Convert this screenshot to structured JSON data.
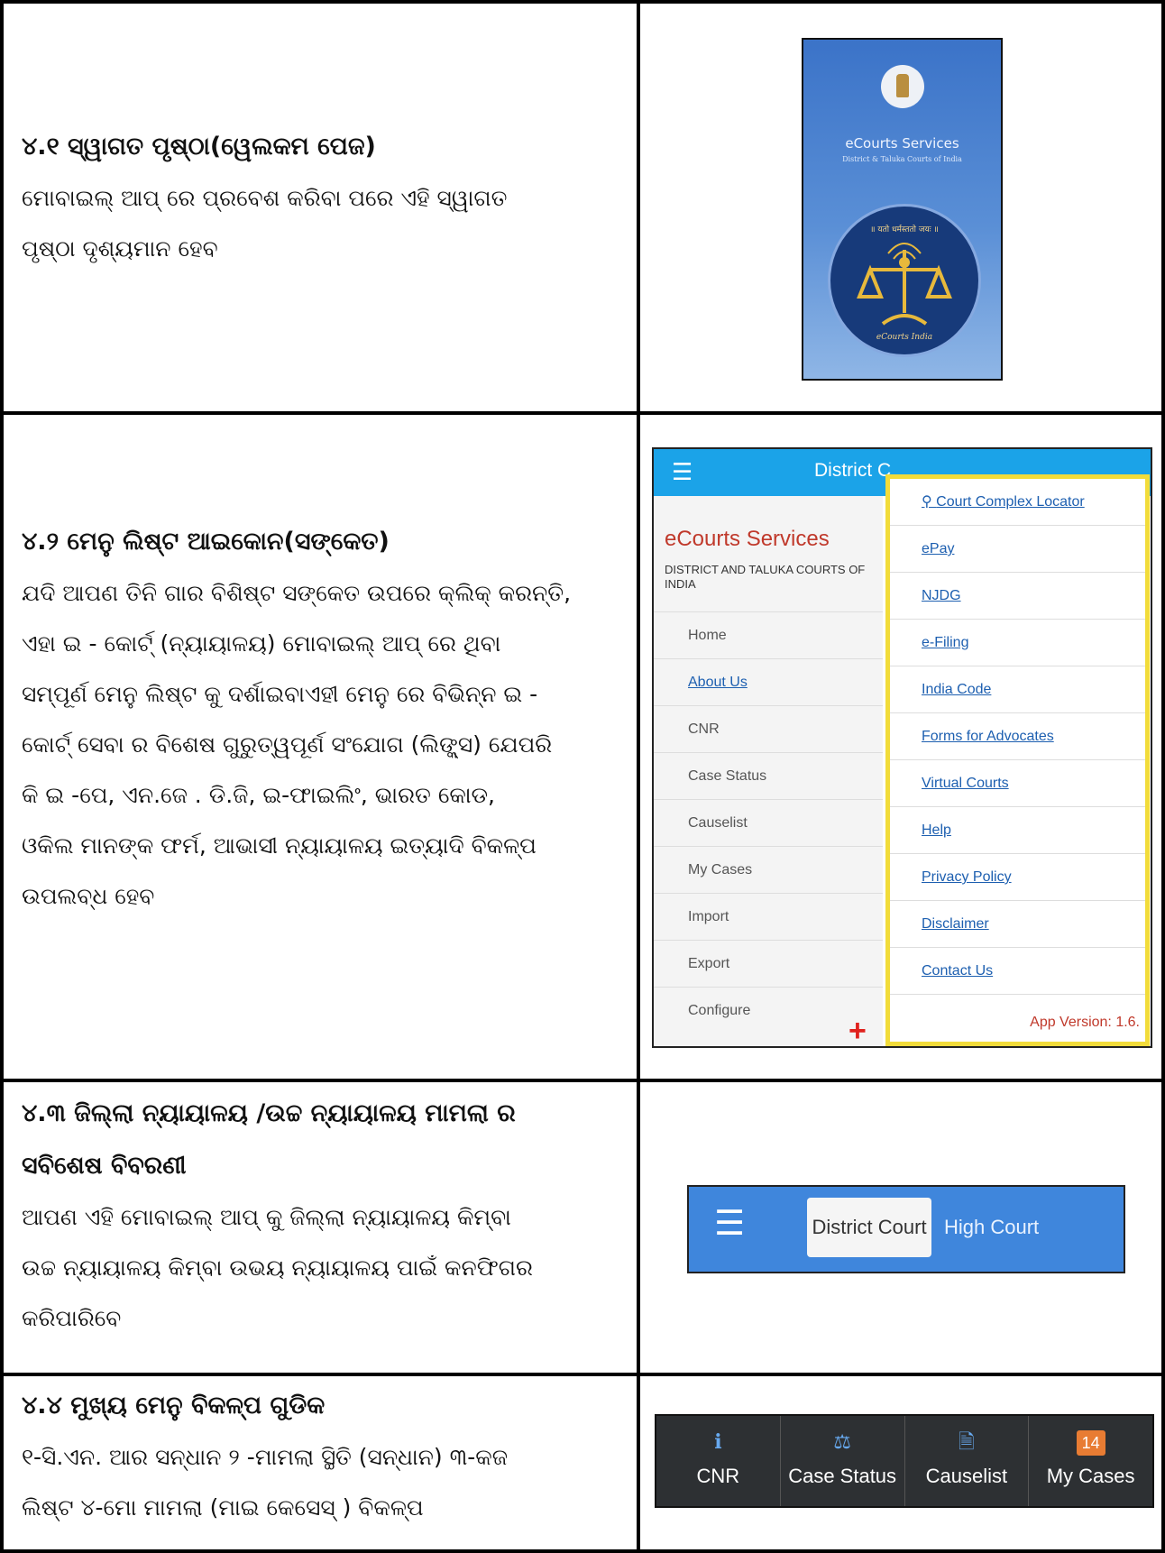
{
  "s41": {
    "heading": "୪.୧ ସ୍ୱାଗତ ପୃଷ୍ଠା(ୱେଲକମ ପେଜ)",
    "line1": "ମୋବାଇଲ୍ ଆପ୍ ରେ ପ୍ରବେଶ କରିବା ପରେ ଏହି ସ୍ୱାଗତ",
    "line2": "ପୃଷ୍ଠା ଦୃଶ୍ୟମାନ ହେବ",
    "screen": {
      "title": "eCourts Services",
      "subtitle": "District & Taluka Courts of India",
      "motto": "॥ यतो धर्मस्ततो जयः ॥",
      "seal_caption": "eCourts India"
    }
  },
  "s42": {
    "heading": "୪.୨ ମେନୁ ଲିଷ୍ଟ ଆଇକୋନ(ସଙ୍କେତ)",
    "lines": [
      " ଯଦି ଆପଣ ତିନି ଗାର ବିଶିଷ୍ଟ ସଙ୍କେତ ଉପରେ କ୍ଲିକ୍ କରନ୍ତି,",
      "ଏହା ଇ -  କୋର୍ଟ୍  (ନ୍ୟାୟାଳୟ)  ମୋବାଇଲ୍ ଆପ୍ ରେ ଥିବା",
      "ସମ୍ପୂର୍ଣ ମେନୁ ଲିଷ୍ଟ କୁ ଦର୍ଶାଇବାଏହୀ ମେନୁ ରେ ବିଭିନ୍ନ ଇ     -",
      "କୋର୍ଟ୍ ସେବା ର ବିଶେଷ ଗୁରୁତ୍ୱପୂର୍ଣ ସଂଯୋଗ (ଲିଙ୍କ୍ସ) ଯେପରି",
      "କି ଇ -ପେ,  ଏନ.ଜେ . ଡି.ଜି,  ଇ-ଫାଇଲିଂ,  ଭାରତ କୋଡ,",
      "ଓକିଲ ମାନଙ୍କ ଫର୍ମ, ଆଭାସୀ ନ୍ୟାୟାଳୟ ଇତ୍ୟାଦି ବିକଳ୍ପ",
      "ଉପଲବ୍ଧ ହେବ"
    ],
    "screen": {
      "bar_title": "District C",
      "brand": "eCourts Services",
      "brand_sub": "DISTRICT AND TALUKA COURTS OF INDIA",
      "left_items": [
        "Home",
        "About Us",
        "CNR",
        "Case Status",
        "Causelist",
        "My Cases",
        "Import",
        "Export",
        "Configure"
      ],
      "right_items": [
        "Court Complex Locator",
        "ePay",
        "NJDG",
        "e-Filing",
        "India Code",
        "Forms for Advocates",
        "Virtual Courts",
        "Help",
        "Privacy Policy",
        "Disclaimer",
        "Contact Us"
      ],
      "version": "App Version: 1.6."
    }
  },
  "s43": {
    "heading_l1": "୪.୩ ଜିଲ୍ଲା ନ୍ୟାୟାଳୟ /ଉଚ୍ଚ ନ୍ୟାୟାଳୟ ମାମଲା ର",
    "heading_l2": "ସବିଶେଷ ବିବରଣୀ",
    "lines": [
      " ଆପଣ ଏହି ମୋବାଇଲ୍ ଆପ୍ କୁ ଜିଲ୍ଲା ନ୍ୟାୟାଳୟ କିମ୍ବା",
      "ଉଚ୍ଚ ନ୍ୟାୟାଳୟ କିମ୍ବା ଉଭୟ ନ୍ୟାୟାଳୟ ପାଇଁ କନଫିଗର",
      "କରିପାରିବେ"
    ],
    "screen": {
      "district": "District Court",
      "high": "High Court"
    }
  },
  "s44": {
    "heading": "୪.୪ ମୁଖ୍ୟ ମେନୁ ବିକଳ୍ପ ଗୁଡିକ",
    "lines": [
      " ୧-ସି.ଏନ. ଆର ସନ୍ଧାନ ୨  -ମାମଲା ସ୍ଥିତି  (ସନ୍ଧାନ)  ୩-କଜ",
      "ଲିଷ୍ଟ ୪-ମୋ ମାମଲା (ମାଇ କେସେସ୍ ) ବିକଳ୍ପ"
    ],
    "tabs": [
      {
        "label": "CNR",
        "icon": "info-icon"
      },
      {
        "label": "Case Status",
        "icon": "scales-icon"
      },
      {
        "label": "Causelist",
        "icon": "document-icon"
      },
      {
        "label": "My Cases",
        "icon": "badge-icon",
        "badge": "14"
      }
    ]
  }
}
